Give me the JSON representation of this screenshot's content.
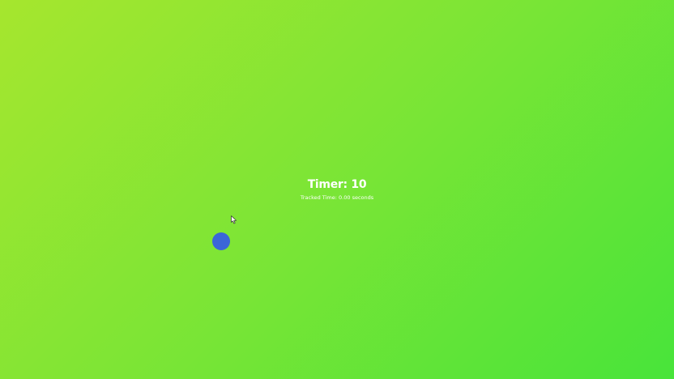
{
  "hud": {
    "timer_label": "Timer:",
    "timer_value": "10",
    "tracked_label": "Tracked Time:",
    "tracked_value": "0.00",
    "tracked_unit": "seconds"
  },
  "target": {
    "color": "#3b66d8"
  },
  "background": {
    "gradient_start": "#a6e62e",
    "gradient_end": "#48e43a"
  },
  "cursor": {
    "icon": "pointer-arrow-icon"
  }
}
